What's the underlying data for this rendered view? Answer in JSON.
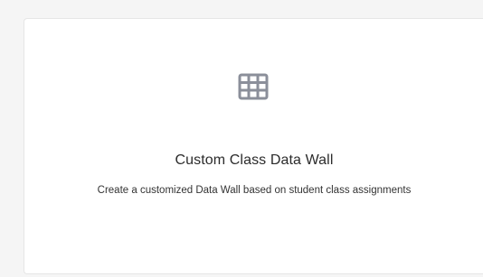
{
  "card": {
    "icon": "grid-table-icon",
    "icon_color": "#8b8f9a",
    "title": "Custom Class Data Wall",
    "description": "Create a customized Data Wall based on student class assignments"
  }
}
